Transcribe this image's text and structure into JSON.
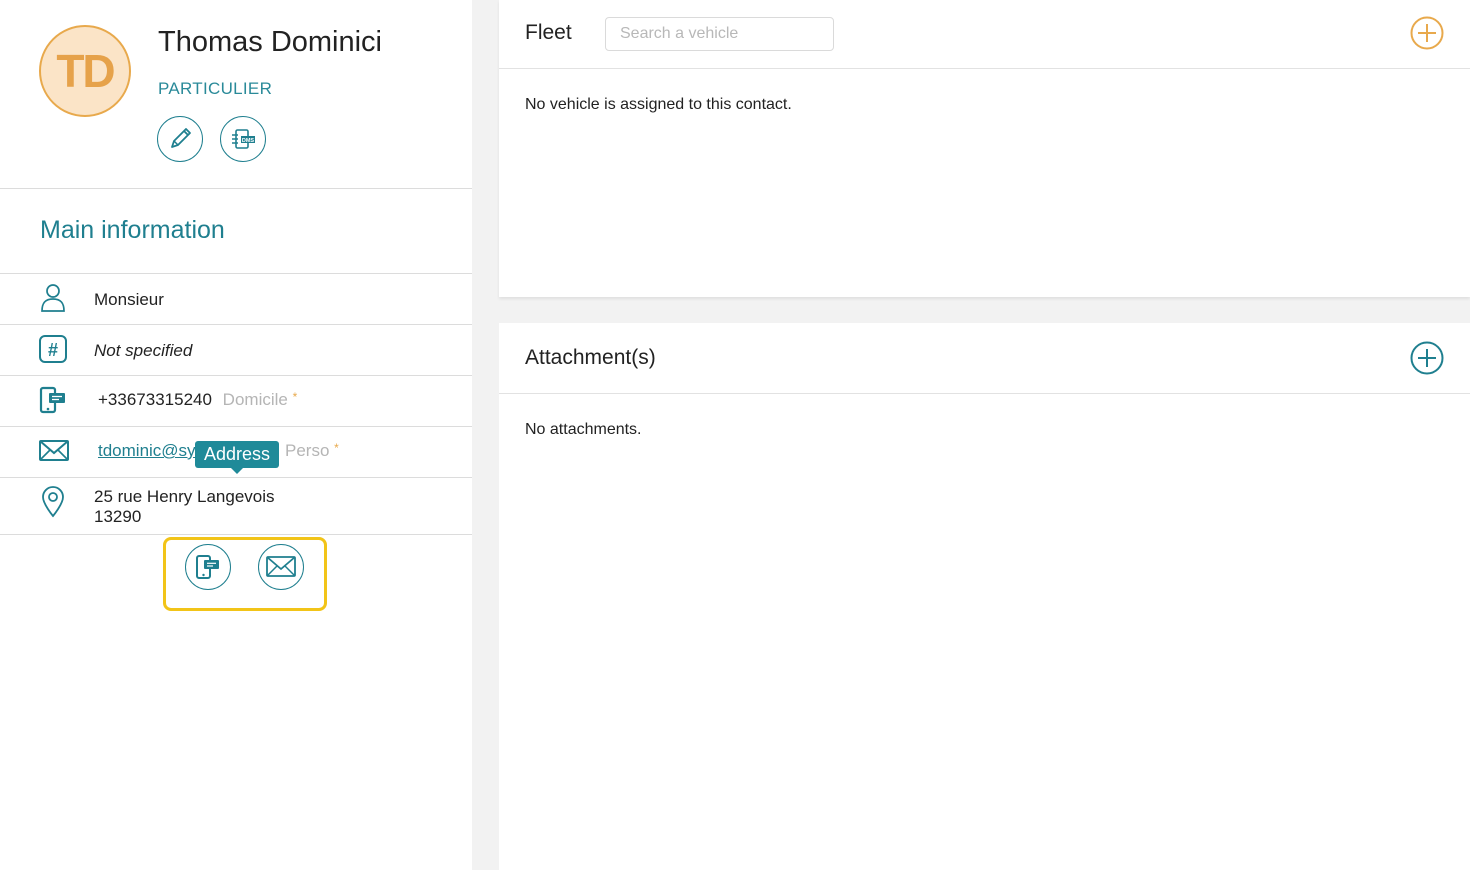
{
  "contact": {
    "initials": "TD",
    "name": "Thomas Dominici",
    "type": "PARTICULIER"
  },
  "main_info": {
    "title": "Main information",
    "civility": "Monsieur",
    "identifier": "Not specified",
    "phone": {
      "number": "+33673315240",
      "label": "Domicile",
      "required": "*"
    },
    "email": {
      "value": "tdominic@sy",
      "label": "Perso",
      "required": "*"
    },
    "address": {
      "line1": "25 rue Henry Langevois",
      "line2": "13290"
    },
    "tooltip": "Address"
  },
  "fleet": {
    "title": "Fleet",
    "search_placeholder": "Search a vehicle",
    "empty_message": "No vehicle is assigned to this contact."
  },
  "attachments": {
    "title": "Attachment(s)",
    "empty_message": "No attachments."
  },
  "colors": {
    "teal": "#1f7f8f",
    "orange": "#e8a94c",
    "highlight": "#f2c418"
  },
  "icons": [
    "pencil-icon",
    "dms-icon",
    "person-icon",
    "hash-icon",
    "phone-message-icon",
    "envelope-icon",
    "location-pin-icon",
    "plus-circle-icon"
  ]
}
